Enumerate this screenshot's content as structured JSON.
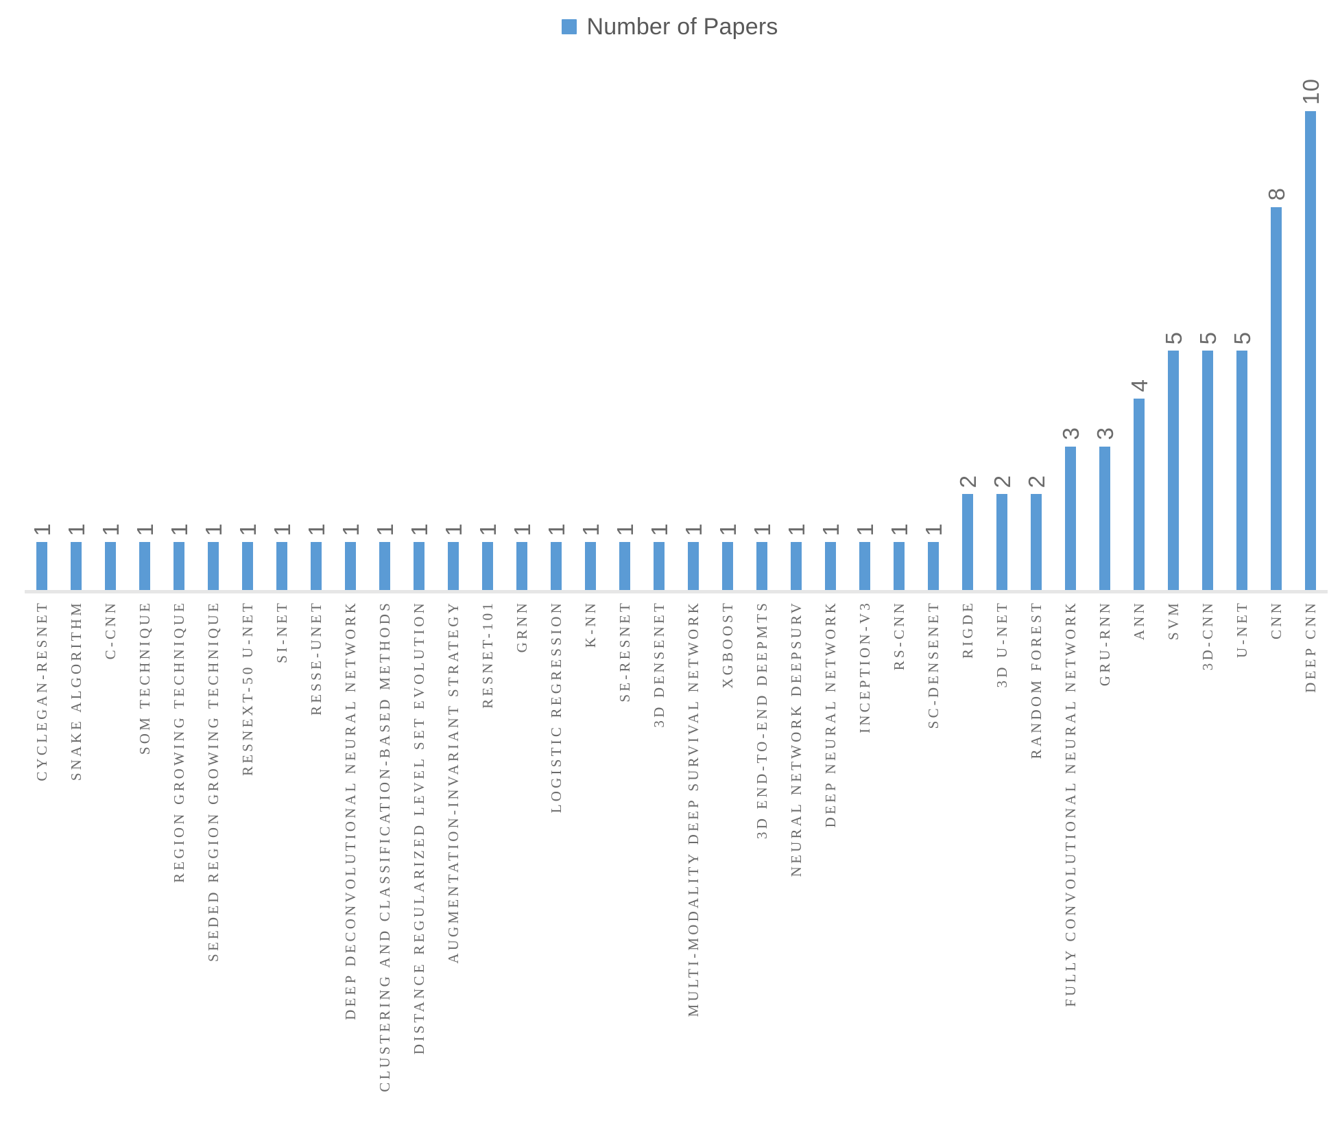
{
  "legend": {
    "swatch_icon": "legend-square-icon",
    "label": "Number of Papers",
    "color": "#5B9BD5"
  },
  "axis": {
    "baseline_color": "#E6E6E6"
  },
  "chart_data": {
    "type": "bar",
    "title": "",
    "xlabel": "",
    "ylabel": "",
    "ylim": [
      0,
      10
    ],
    "grid": false,
    "legend_position": "top-center",
    "series_name": "Number of Papers",
    "series_color": "#5B9BD5",
    "data_labels": true,
    "categories": [
      "CYCLEGAN-RESNET",
      "SNAKE ALGORITHM",
      "C-CNN",
      "SOM TECHNIQUE",
      "REGION GROWING TECHNIQUE",
      "SEEDED REGION GROWING TECHNIQUE",
      "RESNEXT-50 U-NET",
      "SI-NET",
      "RESSE-UNET",
      "DEEP DECONVOLUTIONAL NEURAL NETWORK",
      "CLUSTERING AND CLASSIFICATION-BASED METHODS",
      "DISTANCE REGULARIZED LEVEL SET EVOLUTION",
      "AUGMENTATION-INVARIANT STRATEGY",
      "RESNET-101",
      "GRNN",
      "LOGISTIC REGRESSION",
      "K-NN",
      "SE-RESNET",
      "3D DENSENET",
      "MULTI-MODALITY DEEP SURVIVAL NETWORK",
      "XGBOOST",
      "3D END-TO-END DEEPMTS",
      "NEURAL NETWORK DEEPSURV",
      "DEEP NEURAL NETWORK",
      "INCEPTION-V3",
      "RS-CNN",
      "SC-DENSENET",
      "RIGDE",
      "3D U-NET",
      "RANDOM FOREST",
      "FULLY CONVOLUTIONAL NEURAL NETWORK",
      "GRU-RNN",
      "ANN",
      "SVM",
      "3D-CNN",
      "U-NET",
      "CNN",
      "DEEP CNN"
    ],
    "values": [
      1,
      1,
      1,
      1,
      1,
      1,
      1,
      1,
      1,
      1,
      1,
      1,
      1,
      1,
      1,
      1,
      1,
      1,
      1,
      1,
      1,
      1,
      1,
      1,
      1,
      1,
      1,
      2,
      2,
      2,
      3,
      3,
      4,
      5,
      5,
      5,
      8,
      10
    ]
  }
}
